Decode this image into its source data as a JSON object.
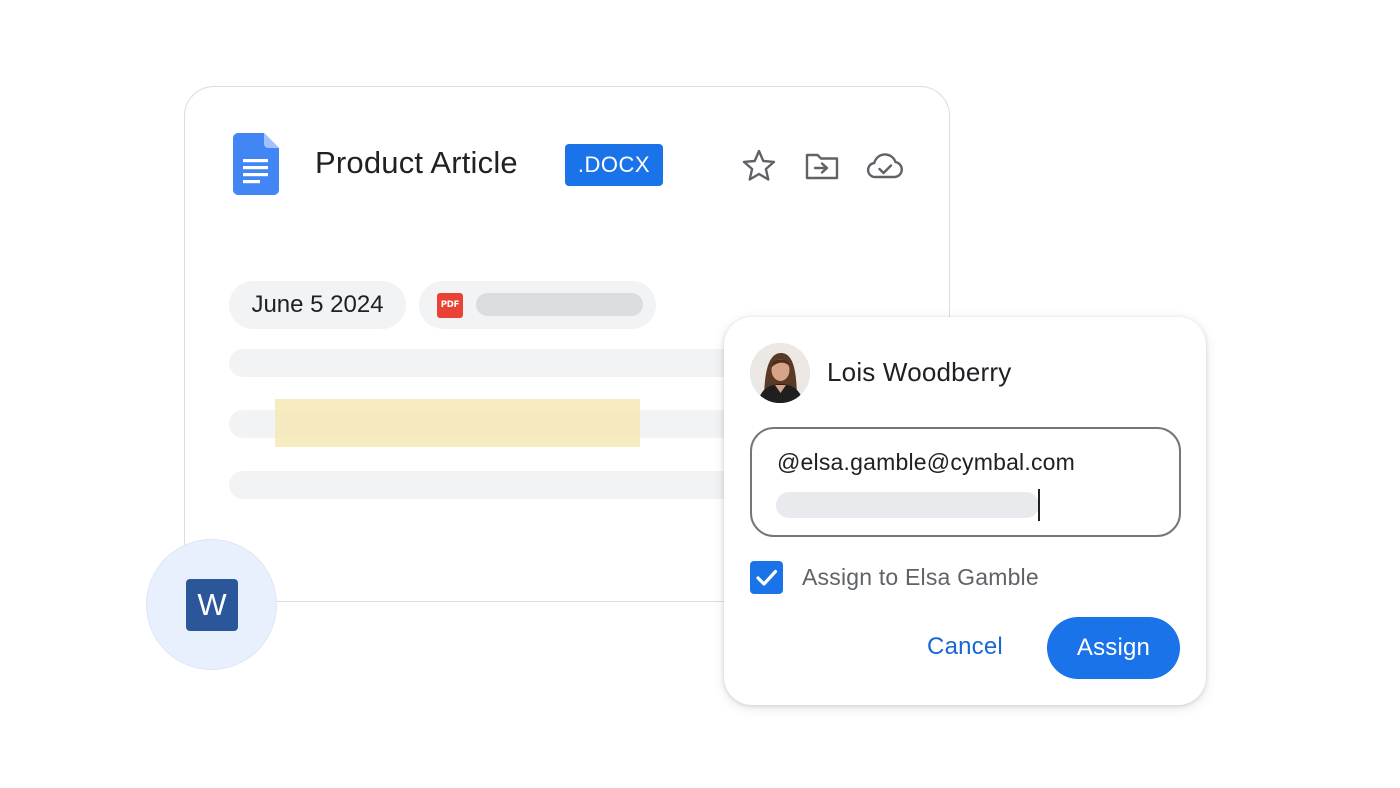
{
  "document": {
    "title": "Product Article",
    "extension_badge": ".DOCX",
    "date_chip": "June 5 2024",
    "attachment_icon": "PDF",
    "toolbar": {
      "icons": [
        "star-icon",
        "move-to-folder-icon",
        "cloud-done-icon"
      ]
    },
    "brand_color": "#1a73e8",
    "highlight_color": "#f6e7b5"
  },
  "word_badge": {
    "letter": "W",
    "color": "#2b579a"
  },
  "assign_dialog": {
    "user_name": "Lois Woodberry",
    "mention_text": "@elsa.gamble@cymbal.com",
    "checkbox_checked": true,
    "checkbox_label": "Assign to Elsa Gamble",
    "cancel_label": "Cancel",
    "assign_label": "Assign",
    "accent_color": "#1a73e8"
  }
}
